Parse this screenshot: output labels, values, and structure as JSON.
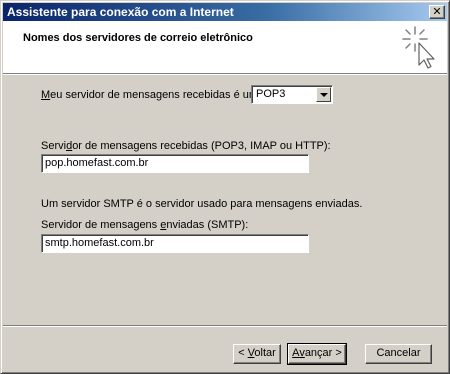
{
  "window": {
    "title": "Assistente para conexão com a Internet",
    "close_glyph": "✕"
  },
  "header": {
    "title": "Nomes dos servidores de correio eletrônico",
    "icon": "wizard-sparkle-cursor-icon"
  },
  "incoming_type": {
    "label_key": "M",
    "label_rest": "eu servidor de mensagens recebidas é um",
    "selected": "POP3"
  },
  "incoming_server": {
    "label_pre": "Servi",
    "label_key": "d",
    "label_post": "or de mensagens recebidas (POP3, IMAP ou HTTP):",
    "value": "pop.homefast.com.br"
  },
  "smtp_info": "Um servidor SMTP é o servidor usado para mensagens enviadas.",
  "outgoing_server": {
    "label_pre": "Servidor de mensagens ",
    "label_key": "e",
    "label_post": "nviadas (SMTP):",
    "value": "smtp.homefast.com.br"
  },
  "buttons": {
    "back": {
      "pre": "< ",
      "key": "V",
      "post": "oltar"
    },
    "next": {
      "key": "A",
      "mid": "v",
      "post": "ançar >"
    },
    "cancel": "Cancelar"
  }
}
